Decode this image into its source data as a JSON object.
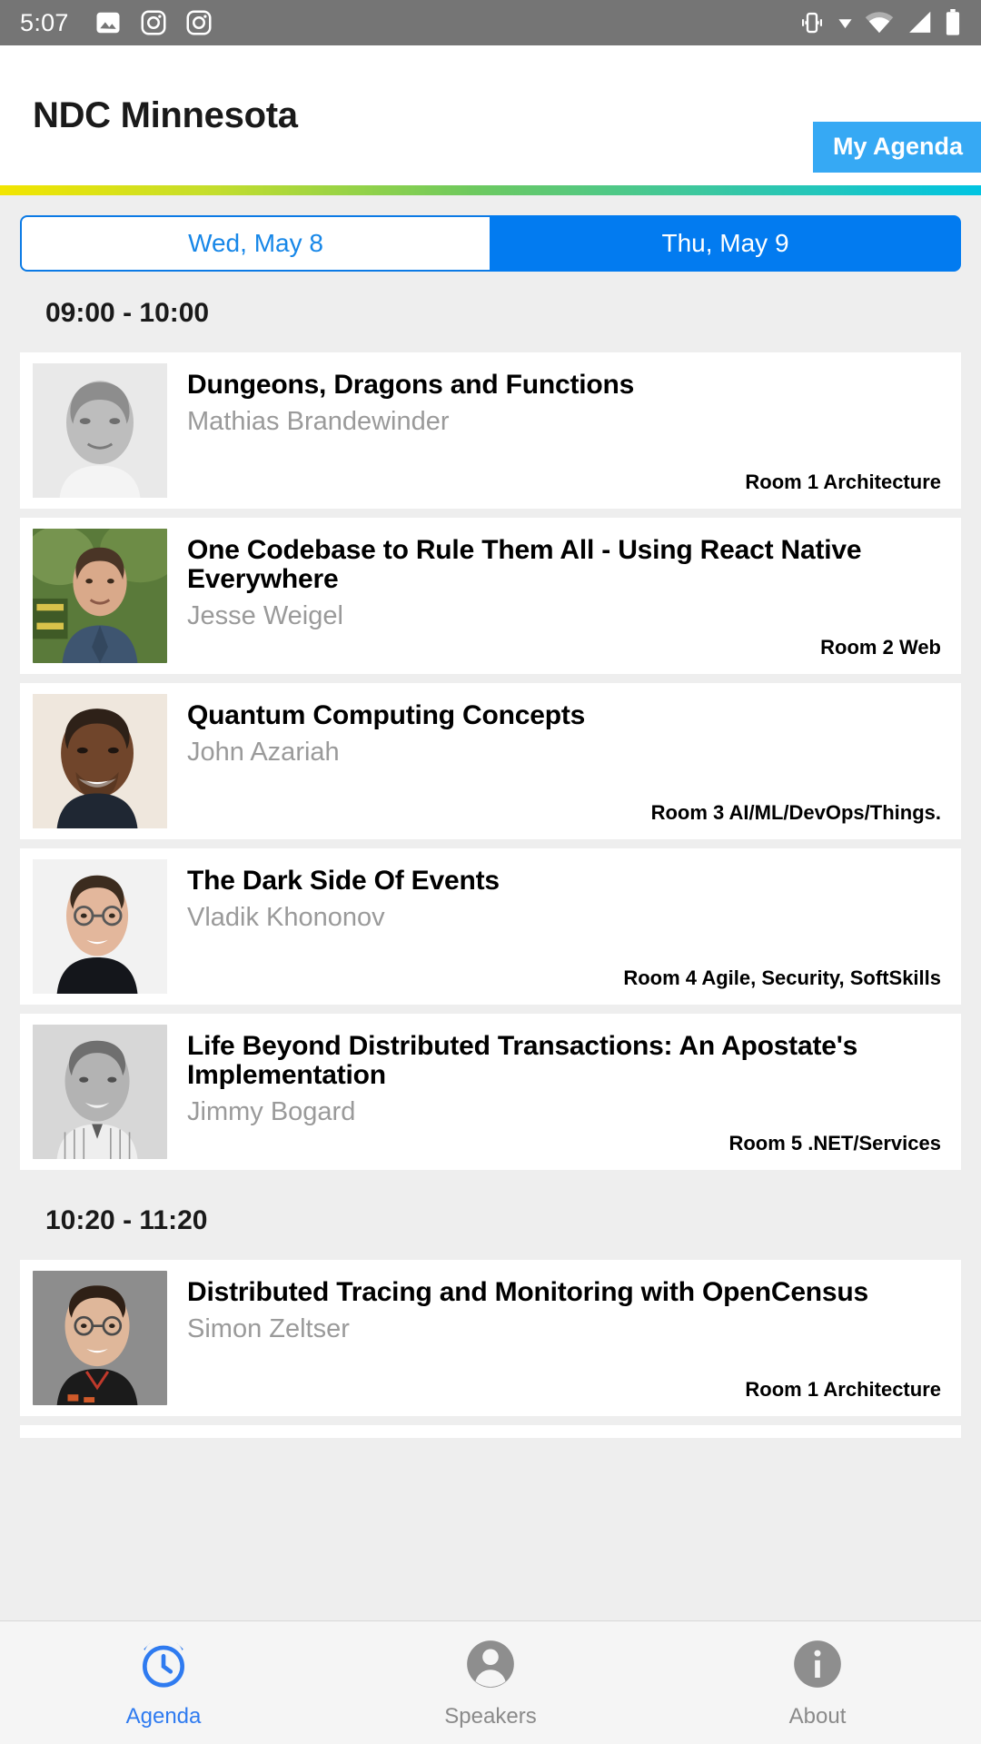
{
  "statusbar": {
    "time": "5:07",
    "left_icons": [
      "image-icon",
      "camera-icon",
      "camera-icon"
    ],
    "right_icons": [
      "vibrate-icon",
      "download-caret-icon",
      "wifi-icon",
      "cellular-signal-icon",
      "battery-icon"
    ]
  },
  "appbar": {
    "title": "NDC Minnesota",
    "my_agenda_label": "My Agenda",
    "accent_button_color": "#36a9f4",
    "gradient_colors": [
      "#f2e500",
      "#6ec95e",
      "#00c4e2"
    ]
  },
  "day_tabs": {
    "selected_index": 1,
    "items": [
      {
        "label": "Wed, May 8",
        "active": false
      },
      {
        "label": "Thu, May 9",
        "active": true
      }
    ],
    "active_color": "#027bf0",
    "inactive_text_color": "#1787e8"
  },
  "agenda": {
    "slots": [
      {
        "time": "09:00 - 10:00",
        "sessions": [
          {
            "title": "Dungeons, Dragons and Functions",
            "speaker": "Mathias Brandewinder",
            "room": "Room 1 Architecture",
            "photo": "portrait-grayscale-bald-man"
          },
          {
            "title": "One Codebase to Rule Them All - Using React Native Everywhere",
            "speaker": "Jesse Weigel",
            "room": "Room 2 Web",
            "photo": "portrait-color-man-outdoors"
          },
          {
            "title": "Quantum Computing Concepts",
            "speaker": "John Azariah",
            "room": "Room 3 AI/ML/DevOps/Things.",
            "photo": "portrait-color-smiling-man"
          },
          {
            "title": "The Dark Side Of Events",
            "speaker": "Vladik Khononov",
            "room": "Room 4 Agile, Security, SoftSkills",
            "photo": "portrait-color-man-glasses"
          },
          {
            "title": "Life Beyond Distributed Transactions: An Apostate's Implementation",
            "speaker": "Jimmy Bogard",
            "room": "Room 5 .NET/Services",
            "photo": "portrait-grayscale-man-shirt"
          }
        ]
      },
      {
        "time": "10:20 - 11:20",
        "sessions": [
          {
            "title": "Distributed Tracing and Monitoring with OpenCensus",
            "speaker": "Simon Zeltser",
            "room": "Room 1 Architecture",
            "photo": "portrait-color-man-black-polo"
          }
        ]
      }
    ]
  },
  "bottom_nav": {
    "active_index": 0,
    "items": [
      {
        "label": "Agenda",
        "icon": "alarm-clock-icon",
        "active": true
      },
      {
        "label": "Speakers",
        "icon": "person-icon",
        "active": false
      },
      {
        "label": "About",
        "icon": "info-icon",
        "active": false
      }
    ],
    "active_color": "#2f7bf0",
    "idle_color": "#8a8a8a"
  }
}
